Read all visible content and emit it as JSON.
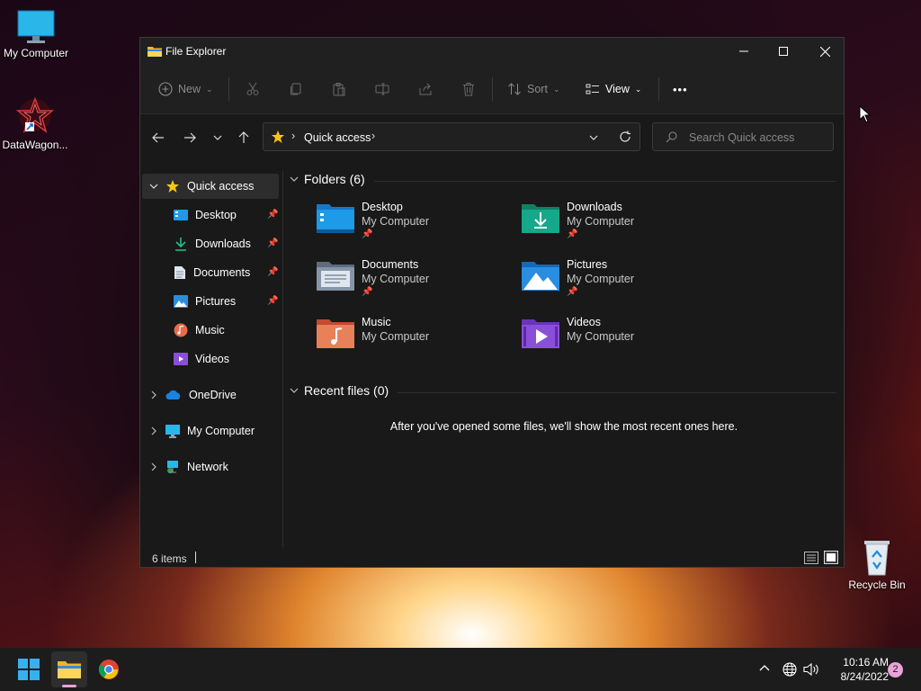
{
  "desktop": {
    "icons": [
      {
        "label": "My Computer"
      },
      {
        "label": "DataWagon..."
      },
      {
        "label": "Recycle Bin"
      }
    ]
  },
  "window": {
    "title": "File Explorer",
    "toolbar": {
      "new_label": "New",
      "sort_label": "Sort",
      "view_label": "View",
      "more_label": "•••"
    },
    "address": {
      "location": "Quick access"
    },
    "search": {
      "placeholder": "Search Quick access"
    },
    "sidebar": {
      "quick_access": "Quick access",
      "items": [
        {
          "label": "Desktop",
          "pinned": true
        },
        {
          "label": "Downloads",
          "pinned": true
        },
        {
          "label": "Documents",
          "pinned": true
        },
        {
          "label": "Pictures",
          "pinned": true
        },
        {
          "label": "Music",
          "pinned": false
        },
        {
          "label": "Videos",
          "pinned": false
        }
      ],
      "roots": [
        {
          "label": "OneDrive"
        },
        {
          "label": "My Computer"
        },
        {
          "label": "Network"
        }
      ]
    },
    "folders_header": "Folders (6)",
    "folders": [
      {
        "name": "Desktop",
        "location": "My Computer",
        "pinned": true,
        "color": "#1e9be8"
      },
      {
        "name": "Downloads",
        "location": "My Computer",
        "pinned": true,
        "color": "#16a88a"
      },
      {
        "name": "Documents",
        "location": "My Computer",
        "pinned": true,
        "color": "#7d8ea3"
      },
      {
        "name": "Pictures",
        "location": "My Computer",
        "pinned": true,
        "color": "#2a8de0"
      },
      {
        "name": "Music",
        "location": "My Computer",
        "pinned": false,
        "color": "#e86a4a"
      },
      {
        "name": "Videos",
        "location": "My Computer",
        "pinned": false,
        "color": "#8a4fd8"
      }
    ],
    "recent_header": "Recent files (0)",
    "recent_empty": "After you've opened some files, we'll show the most recent ones here.",
    "status": {
      "items": "6 items"
    }
  },
  "taskbar": {
    "time": "10:16 AM",
    "date": "8/24/2022",
    "notifications": "2"
  }
}
